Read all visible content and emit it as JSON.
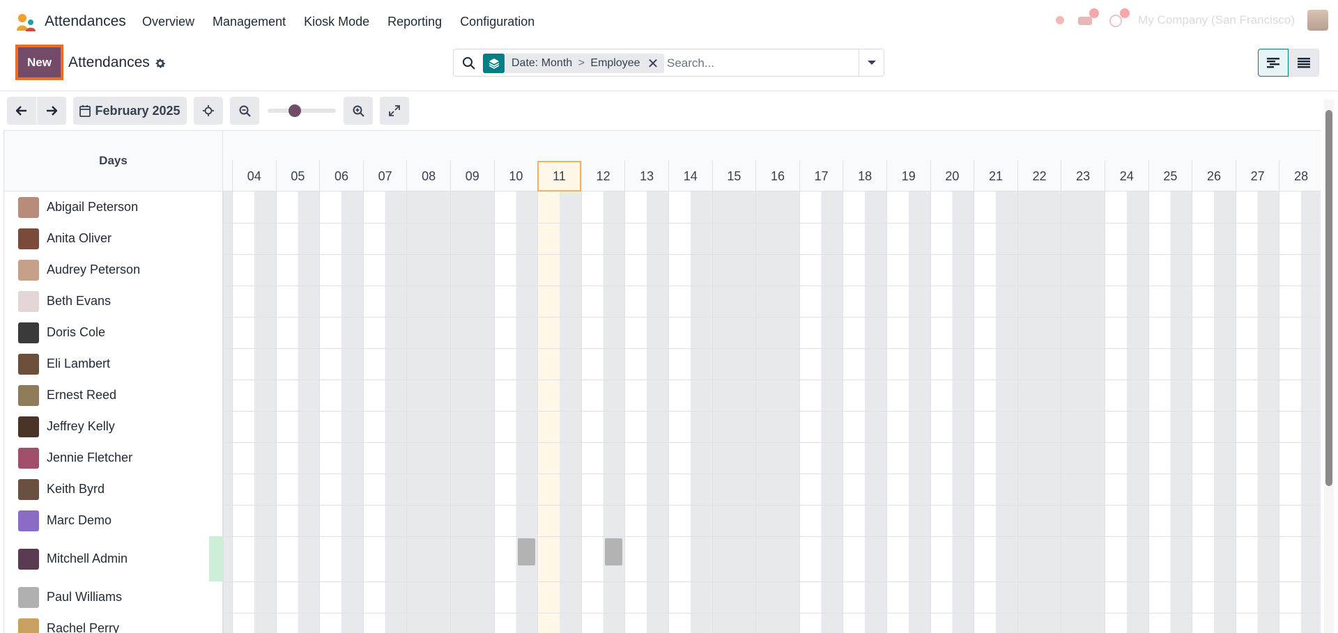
{
  "app": {
    "title": "Attendances"
  },
  "menu": [
    "Overview",
    "Management",
    "Kiosk Mode",
    "Reporting",
    "Configuration"
  ],
  "systray": {
    "company": "My Company (San Francisco)"
  },
  "control": {
    "new_label": "New",
    "title": "Attendances"
  },
  "search": {
    "facet_group": "Date: Month",
    "facet_sep": ">",
    "facet_value": "Employee",
    "placeholder": "Search..."
  },
  "toolbar": {
    "period": "February 2025",
    "zoom_level": 0.4
  },
  "gantt": {
    "rows_header": "Days",
    "days": [
      "04",
      "05",
      "06",
      "07",
      "08",
      "09",
      "10",
      "11",
      "12",
      "13",
      "14",
      "15",
      "16",
      "17",
      "18",
      "19",
      "20",
      "21",
      "22",
      "23",
      "24",
      "25",
      "26",
      "27",
      "28"
    ],
    "today": "11",
    "employees": [
      "Abigail Peterson",
      "Anita Oliver",
      "Audrey Peterson",
      "Beth Evans",
      "Doris Cole",
      "Eli Lambert",
      "Ernest Reed",
      "Jeffrey Kelly",
      "Jennie Fletcher",
      "Keith Byrd",
      "Marc Demo",
      "Mitchell Admin",
      "Paul Williams",
      "Rachel Perry"
    ],
    "attendance_pills": [
      {
        "employee": "Mitchell Admin",
        "day": "10"
      },
      {
        "employee": "Mitchell Admin",
        "day": "12"
      }
    ]
  },
  "colors": {
    "brand": "#714b67",
    "accent": "#017e84",
    "highlight": "#f36b1f",
    "today": "#fff8e8"
  },
  "icons": {
    "brand": "attendances-logo-icon",
    "gear": "gear-icon",
    "search": "search-icon",
    "facet": "layers-icon",
    "prev": "arrow-left-icon",
    "next": "arrow-right-icon",
    "calendar": "calendar-icon",
    "focus": "crosshair-icon",
    "zoom_out": "zoom-out-icon",
    "zoom_in": "zoom-in-icon",
    "expand": "expand-icon",
    "gantt_view": "gantt-view-icon",
    "list_view": "list-view-icon"
  }
}
